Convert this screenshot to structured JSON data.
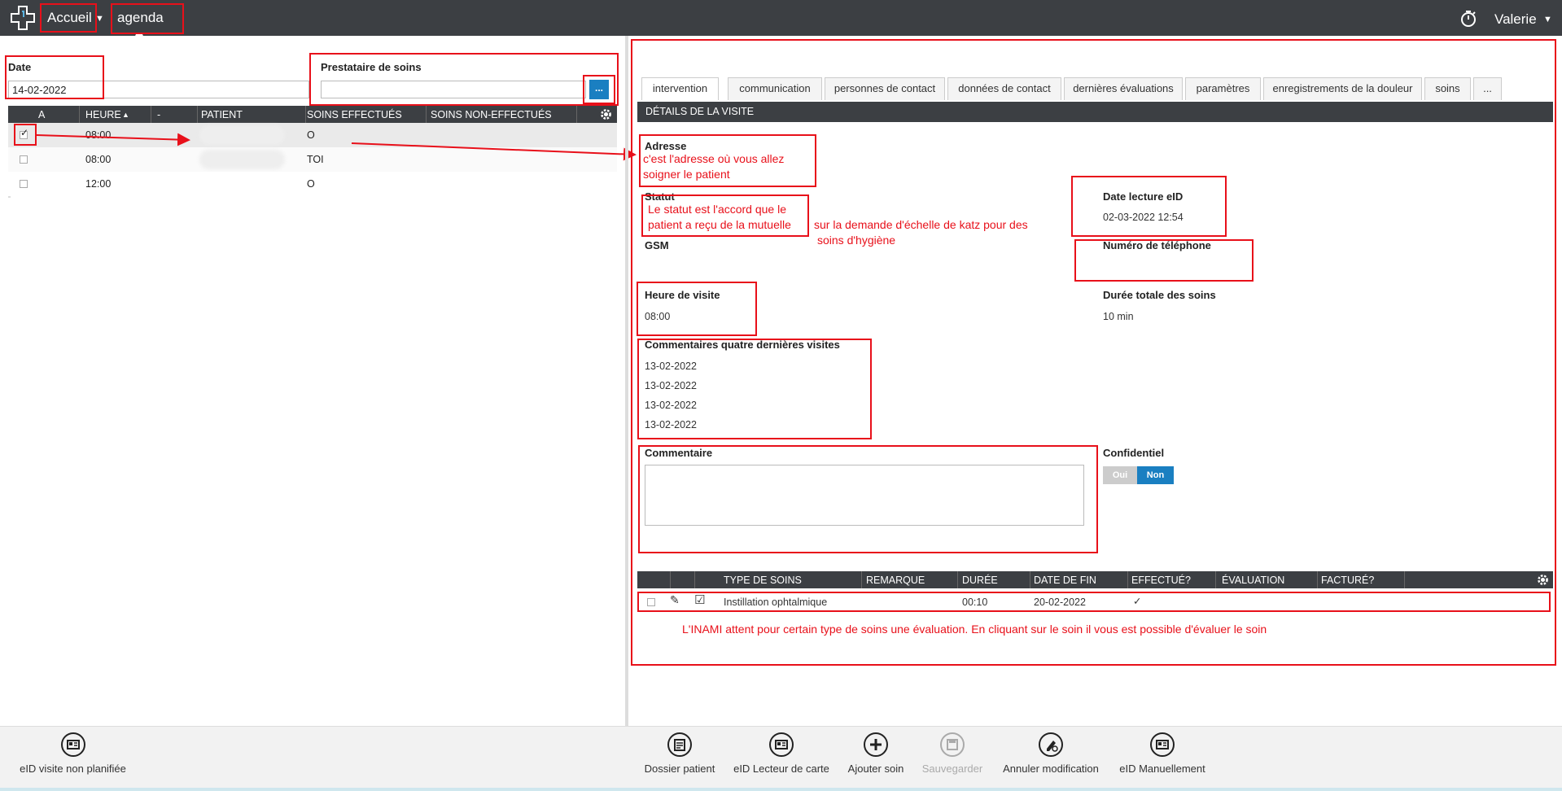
{
  "topbar": {
    "home_label": "Accueil",
    "agenda_label": "agenda",
    "user_name": "Valerie"
  },
  "filters": {
    "date_label": "Date",
    "date_value": "14-02-2022",
    "provider_label": "Prestataire de soins",
    "provider_value": "",
    "provider_button_label": "..."
  },
  "agenda_grid": {
    "columns": [
      "A",
      "HEURE",
      "-",
      "PATIENT",
      "SOINS EFFECTUÉS",
      "SOINS NON-EFFECTUÉS"
    ],
    "rows": [
      {
        "time": "08:00",
        "done": "O",
        "checked": true
      },
      {
        "time": "08:00",
        "done": "TOI",
        "checked": false
      },
      {
        "time": "12:00",
        "done": "O",
        "checked": false
      }
    ]
  },
  "tabs": [
    "intervention",
    "communication",
    "personnes de contact",
    "données de contact",
    "dernières évaluations",
    "paramètres",
    "enregistrements de la douleur",
    "soins",
    "..."
  ],
  "details": {
    "section_title": "DÉTAILS DE LA VISITE",
    "address_label": "Adresse",
    "status_label": "Statut",
    "gsm_label": "GSM",
    "eid_date_label": "Date lecture eID",
    "eid_date_value": "02-03-2022 12:54",
    "phone_label": "Numéro de téléphone",
    "visit_time_label": "Heure de visite",
    "visit_time_value": "08:00",
    "total_duration_label": "Durée totale des soins",
    "total_duration_value": "10 min",
    "comments_last_label": "Commentaires quatre dernières visites",
    "comments_last": [
      "13-02-2022",
      "13-02-2022",
      "13-02-2022",
      "13-02-2022"
    ],
    "comment_label": "Commentaire",
    "confidential_label": "Confidentiel",
    "confidential_yes": "Oui",
    "confidential_no": "Non"
  },
  "soins_grid": {
    "columns": [
      "TYPE DE SOINS",
      "REMARQUE",
      "DURÉE",
      "DATE DE FIN",
      "EFFECTUÉ?",
      "ÉVALUATION",
      "FACTURÉ?"
    ],
    "row": {
      "type": "Instillation ophtalmique",
      "remark": "",
      "duration": "00:10",
      "end_date": "20-02-2022",
      "done": "✓"
    }
  },
  "annotations": {
    "address_note_1": "c'est l'adresse où vous allez",
    "address_note_2": "soigner le patient",
    "status_note_1": "Le statut est l'accord que le",
    "status_note_2": "patient a reçu de la mutuelle",
    "status_note_3": "sur la demande d'échelle de katz pour des",
    "status_note_4": "soins d'hygiène",
    "inami_note": "L'INAMI attent pour certain type de soins une évaluation. En cliquant sur le soin il vous est possible d'évaluer le soin"
  },
  "bottom_actions": {
    "eid_unplanned": "eID visite non planifiée",
    "patient_file": "Dossier patient",
    "eid_reader": "eID Lecteur de carte",
    "add_care": "Ajouter soin",
    "save": "Sauvegarder",
    "cancel_edit": "Annuler modification",
    "eid_manual": "eID Manuellement"
  }
}
